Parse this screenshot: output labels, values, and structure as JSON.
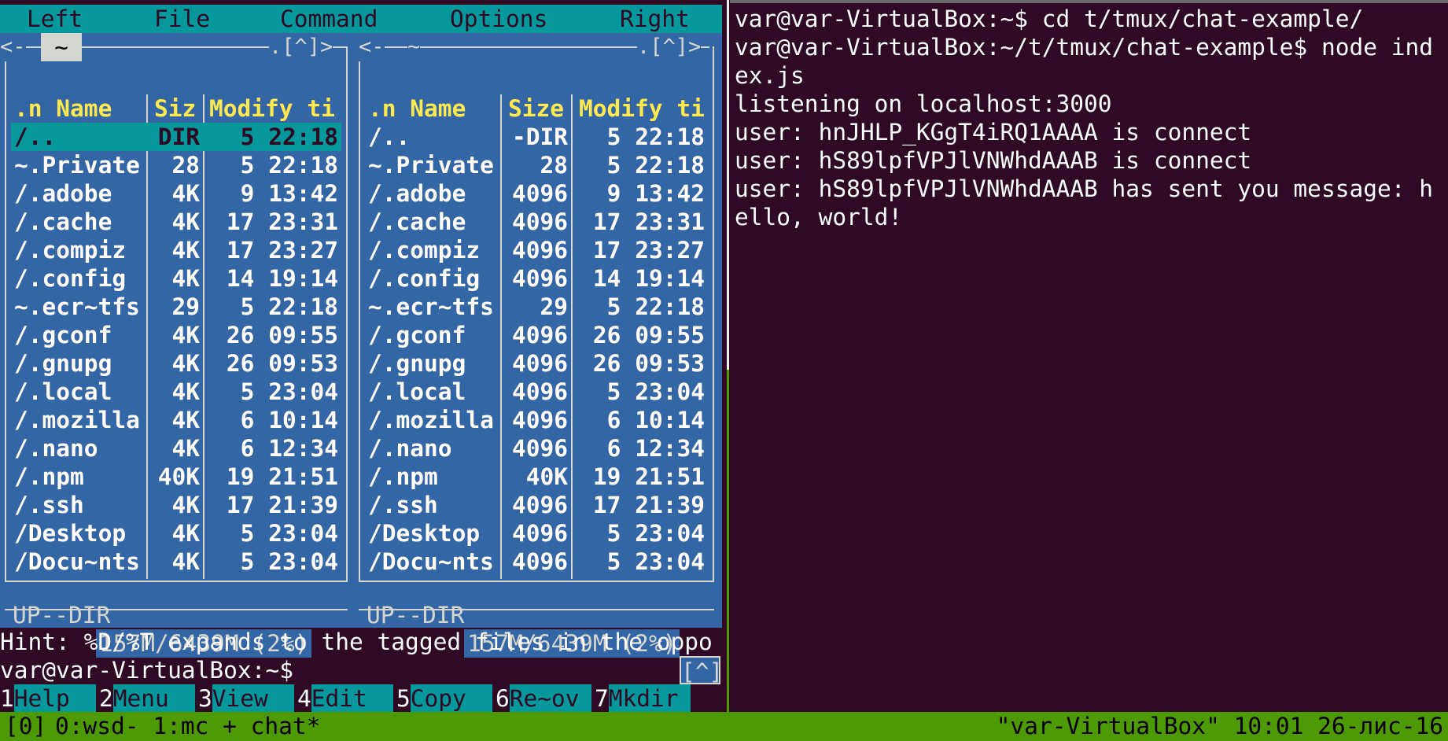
{
  "mc": {
    "menu": [
      "Left",
      "File",
      "Command",
      "Options",
      "Right"
    ],
    "left_panel": {
      "hotlist": "<-",
      "dir": "~",
      "top_right": ".[^]>",
      "headers": {
        "name": ".n Name",
        "size": "Siz",
        "time": "Modify ti"
      },
      "rows": [
        {
          "name": "/..",
          "size": "DIR",
          "time": "5 22:18",
          "selected": true
        },
        {
          "name": "~.Private",
          "size": "28",
          "time": "5 22:18"
        },
        {
          "name": "/.adobe",
          "size": "4K",
          "time": "9 13:42"
        },
        {
          "name": "/.cache",
          "size": "4K",
          "time": "17 23:31"
        },
        {
          "name": "/.compiz",
          "size": "4K",
          "time": "17 23:27"
        },
        {
          "name": "/.config",
          "size": "4K",
          "time": "14 19:14"
        },
        {
          "name": "~.ecr~tfs",
          "size": "29",
          "time": "5 22:18"
        },
        {
          "name": "/.gconf",
          "size": "4K",
          "time": "26 09:55"
        },
        {
          "name": "/.gnupg",
          "size": "4K",
          "time": "26 09:53"
        },
        {
          "name": "/.local",
          "size": "4K",
          "time": "5 23:04"
        },
        {
          "name": "/.mozilla",
          "size": "4K",
          "time": "6 10:14"
        },
        {
          "name": "/.nano",
          "size": "4K",
          "time": "6 12:34"
        },
        {
          "name": "/.npm",
          "size": "40K",
          "time": "19 21:51"
        },
        {
          "name": "/.ssh",
          "size": "4K",
          "time": "17 21:39"
        },
        {
          "name": "/Desktop",
          "size": "4K",
          "time": "5 23:04"
        },
        {
          "name": "/Docu~nts",
          "size": "4K",
          "time": "5 23:04"
        }
      ],
      "status": "UP--DIR",
      "disk": "157M/6439M (2%)"
    },
    "right_panel": {
      "hotlist": "<-",
      "dir": "~",
      "top_right": ".[^]>",
      "headers": {
        "name": ".n Name",
        "size": "Size",
        "time": "Modify ti"
      },
      "rows": [
        {
          "name": "/..",
          "size": "-DIR",
          "time": "5 22:18"
        },
        {
          "name": "~.Private",
          "size": "28",
          "time": "5 22:18"
        },
        {
          "name": "/.adobe",
          "size": "4096",
          "time": "9 13:42"
        },
        {
          "name": "/.cache",
          "size": "4096",
          "time": "17 23:31"
        },
        {
          "name": "/.compiz",
          "size": "4096",
          "time": "17 23:27"
        },
        {
          "name": "/.config",
          "size": "4096",
          "time": "14 19:14"
        },
        {
          "name": "~.ecr~tfs",
          "size": "29",
          "time": "5 22:18"
        },
        {
          "name": "/.gconf",
          "size": "4096",
          "time": "26 09:55"
        },
        {
          "name": "/.gnupg",
          "size": "4096",
          "time": "26 09:53"
        },
        {
          "name": "/.local",
          "size": "4096",
          "time": "5 23:04"
        },
        {
          "name": "/.mozilla",
          "size": "4096",
          "time": "6 10:14"
        },
        {
          "name": "/.nano",
          "size": "4096",
          "time": "6 12:34"
        },
        {
          "name": "/.npm",
          "size": "40K",
          "time": "19 21:51"
        },
        {
          "name": "/.ssh",
          "size": "4096",
          "time": "17 21:39"
        },
        {
          "name": "/Desktop",
          "size": "4096",
          "time": "5 23:04"
        },
        {
          "name": "/Docu~nts",
          "size": "4096",
          "time": "5 23:04"
        }
      ],
      "status": "UP--DIR",
      "disk": "157M/6439M (2%)"
    },
    "hint": "Hint: %D/%T expands to the tagged files in the oppo",
    "prompt": "var@var-VirtualBox:~$",
    "prompt_arrow": "[^]",
    "fkeys": [
      {
        "num": "1",
        "label": "Help"
      },
      {
        "num": "2",
        "label": "Menu"
      },
      {
        "num": "3",
        "label": "View"
      },
      {
        "num": "4",
        "label": "Edit"
      },
      {
        "num": "5",
        "label": "Copy"
      },
      {
        "num": "6",
        "label": "Re~ov"
      },
      {
        "num": "7",
        "label": "Mkdir"
      }
    ]
  },
  "terminal": {
    "lines": [
      "var@var-VirtualBox:~$ cd t/tmux/chat-example/",
      "var@var-VirtualBox:~/t/tmux/chat-example$ node ind",
      "ex.js",
      "listening on localhost:3000",
      "user: hnJHLP_KGgT4iRQ1AAAA is connect",
      "user: hS89lpfVPJlVNWhdAAAB is connect",
      "user: hS89lpfVPJlVNWhdAAAB has sent you message: h",
      "ello, world!"
    ]
  },
  "tmux": {
    "session": "[0]",
    "windows": "0:wsd- 1:mc + chat*",
    "right_status": "\"var-VirtualBox\" 10:01 26-лис-16"
  },
  "colors": {
    "mc_blue": "#3465a4",
    "mc_cyan": "#06989a",
    "header_yellow": "#fce94f",
    "terminal_bg": "#300a24",
    "tmux_green": "#4e9a06"
  }
}
